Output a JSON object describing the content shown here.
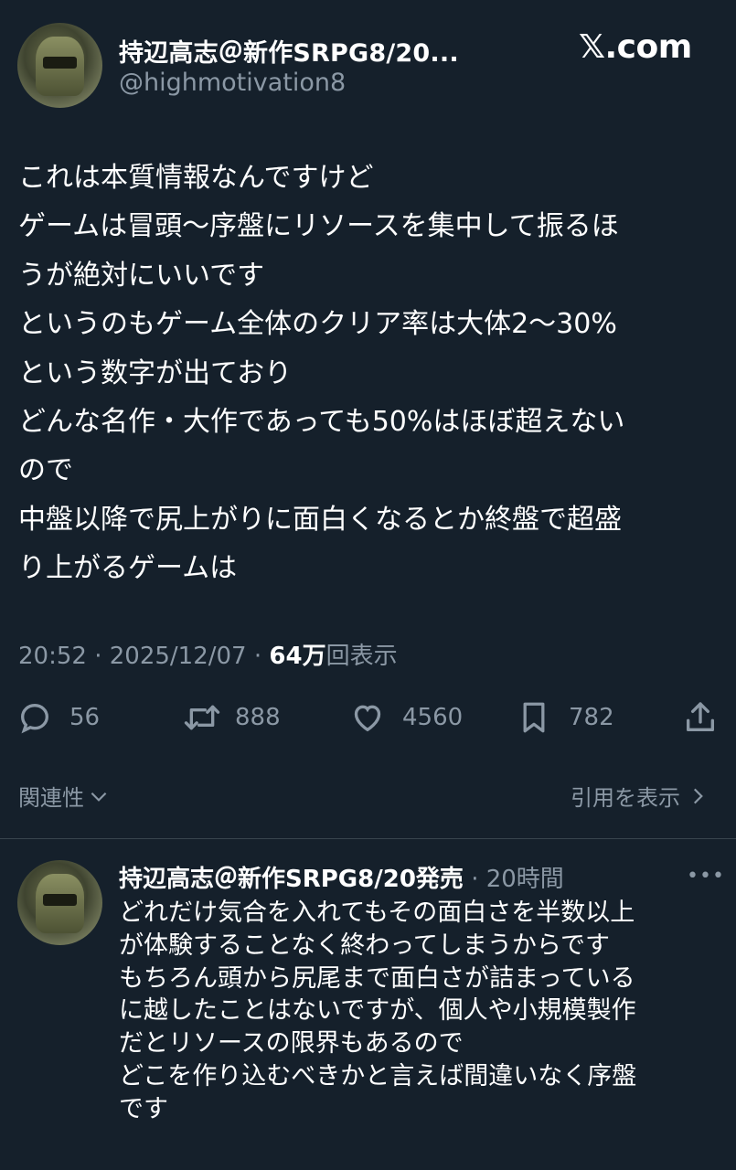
{
  "header": {
    "display_name": "持辺高志＠新作SRPG8/20...",
    "handle": "@highmotivation8",
    "site_logo": "𝕏.com"
  },
  "tweet": {
    "lines": [
      "これは本質情報なんですけど",
      "ゲームは冒頭〜序盤にリソースを集中して振るほ",
      "うが絶対にいいです",
      "というのもゲーム全体のクリア率は大体2〜30%",
      "という数字が出ており",
      "どんな名作・大作であっても50%はほぼ超えない",
      "ので",
      "中盤以降で尻上がりに面白くなるとか終盤で超盛",
      "り上がるゲームは"
    ],
    "time": "20:52",
    "date": "2025/12/07",
    "views_count": "64万",
    "views_label": "回表示"
  },
  "actions": {
    "replies": "56",
    "retweets": "888",
    "likes": "4560",
    "bookmarks": "782"
  },
  "sections": {
    "related": "関連性",
    "show_quotes": "引用を表示"
  },
  "reply": {
    "display_name": "持辺高志＠新作SRPG8/20発売",
    "time": "20時間",
    "more": "•••",
    "lines": [
      "どれだけ気合を入れてもその面白さを半数以上",
      "が体験することなく終わってしまうからです",
      "もちろん頭から尻尾まで面白さが詰まっている",
      "に越したことはないですが、個人や小規模製作",
      "だとリソースの限界もあるので",
      "どこを作り込むべきかと言えば間違いなく序盤",
      "です"
    ]
  },
  "colors": {
    "background": "#15202b",
    "text": "#ffffff",
    "secondary": "#8b98a5",
    "divider": "#38444d"
  }
}
